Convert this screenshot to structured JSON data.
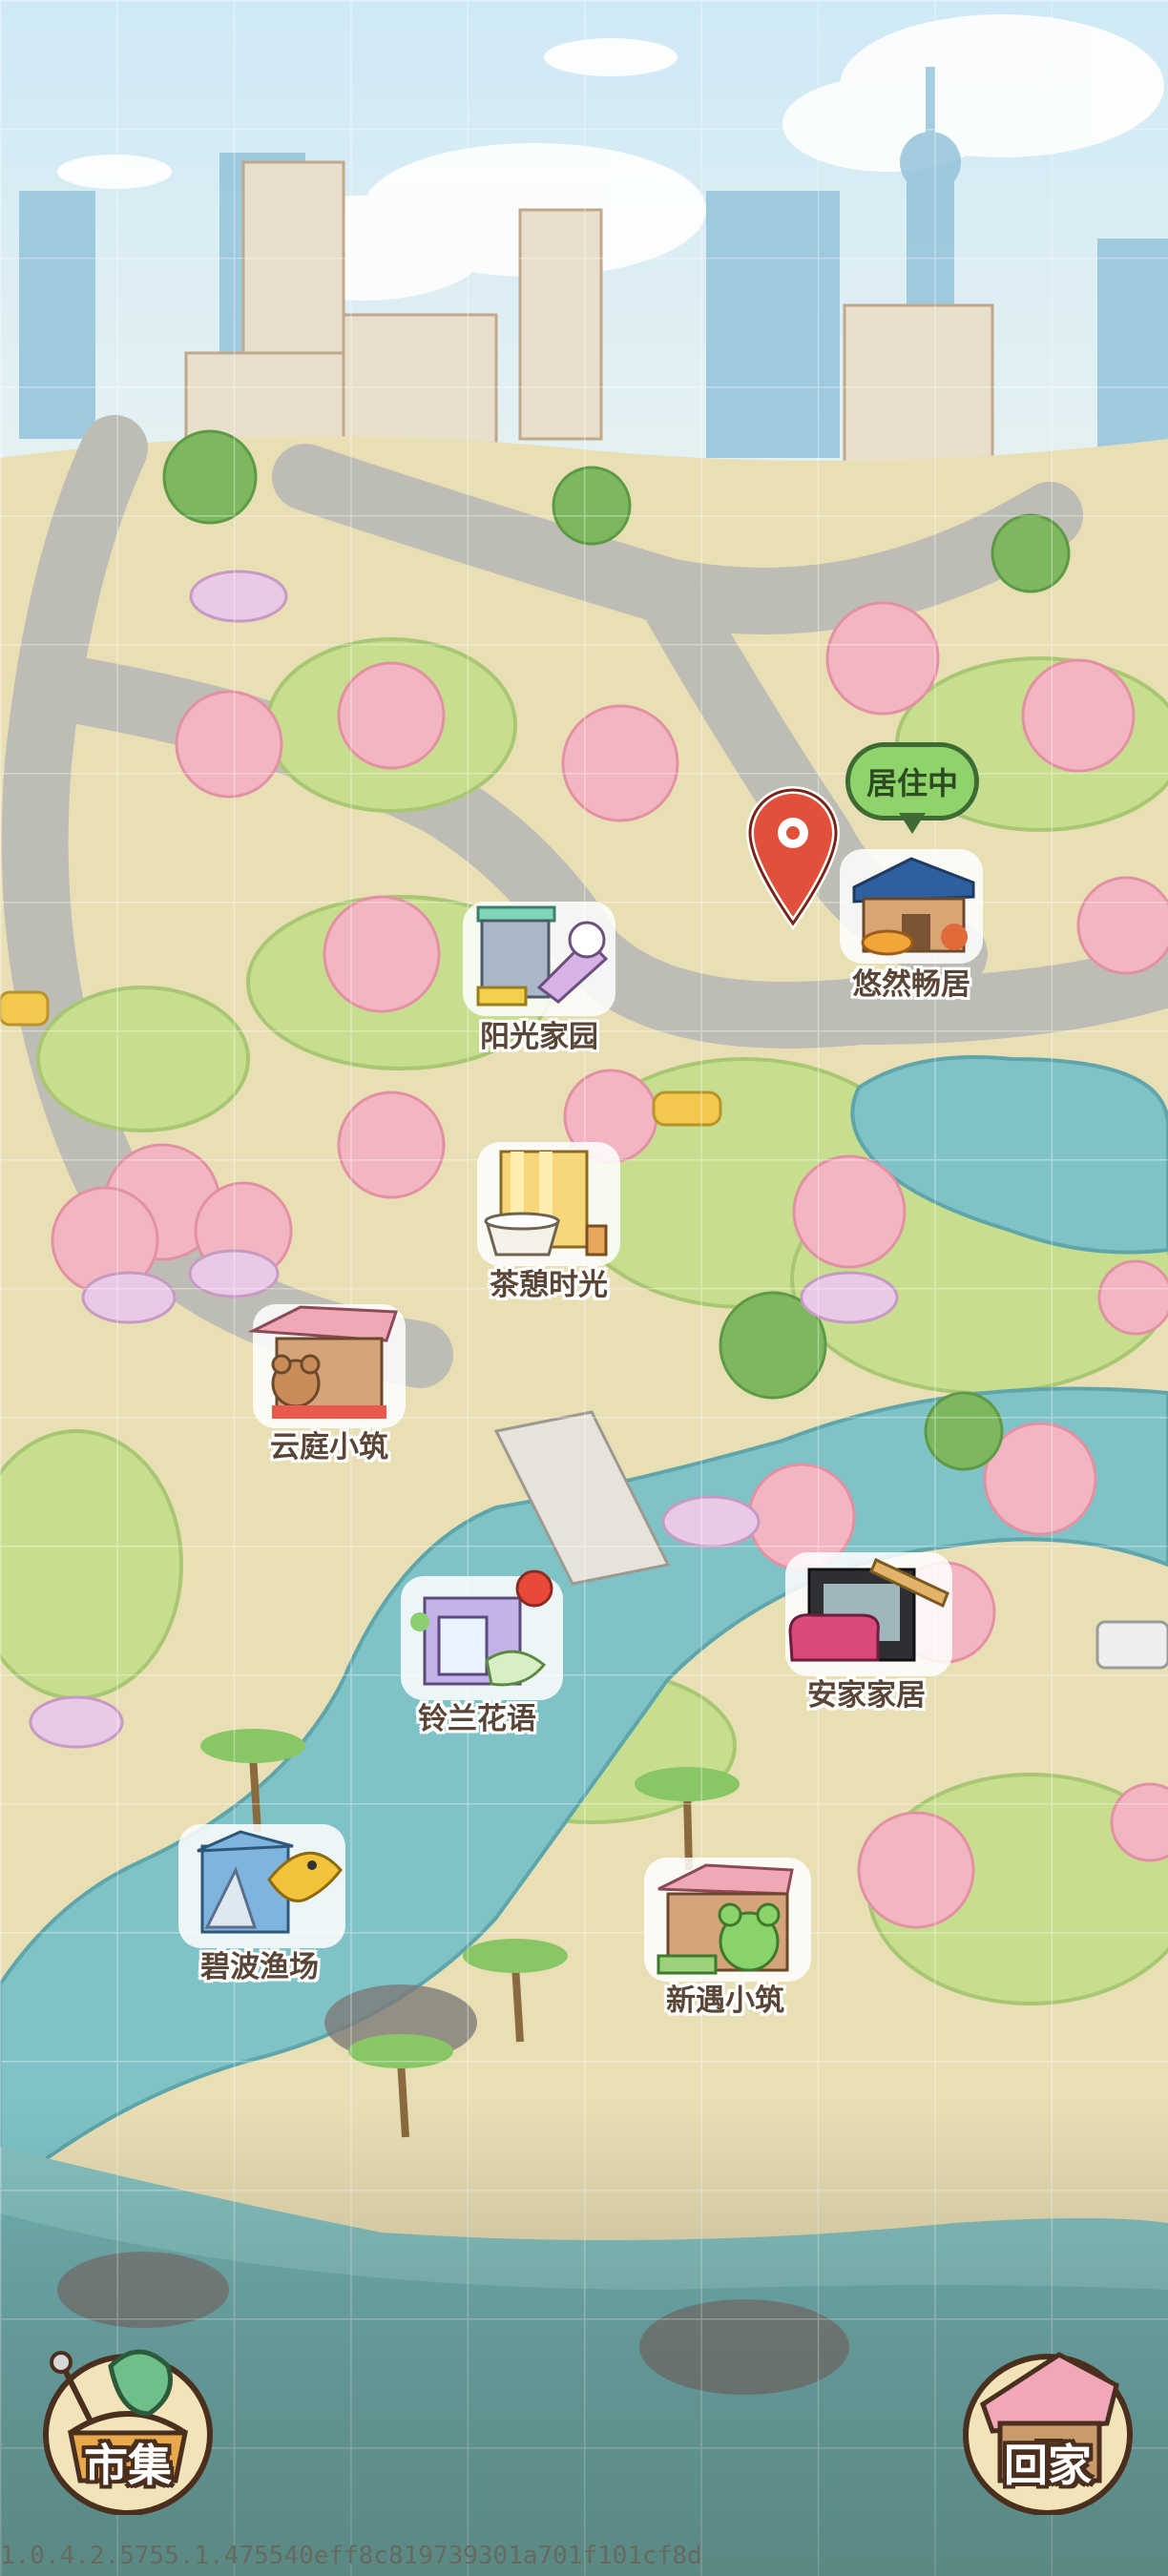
{
  "map": {
    "locations": [
      {
        "id": "sunshine",
        "name": "阳光家园"
      },
      {
        "id": "youran",
        "name": "悠然畅居"
      },
      {
        "id": "tea",
        "name": "茶憩时光"
      },
      {
        "id": "yunting",
        "name": "云庭小筑"
      },
      {
        "id": "lingl",
        "name": "铃兰花语"
      },
      {
        "id": "anjia",
        "name": "安家家居"
      },
      {
        "id": "bibo",
        "name": "碧波渔场"
      },
      {
        "id": "xinyu",
        "name": "新遇小筑"
      }
    ],
    "residing_badge": "居住中",
    "current_pin_icon": "map-pin-icon"
  },
  "buttons": {
    "market": {
      "label": "市集",
      "icon": "basket-icon"
    },
    "home": {
      "label": "回家",
      "icon": "house-icon"
    }
  },
  "version": "1.0.4.2.5755.1.475540eff8c819739301a701f101cf8d",
  "colors": {
    "water": "#7fc3c6",
    "grass": "#c3dc8a",
    "sand": "#efdcae",
    "road": "#b9b9b4",
    "sakura": "#f2b6c2",
    "sky": "#bfe2f2",
    "badge": "#8ed46a",
    "pin": "#e0503a"
  }
}
